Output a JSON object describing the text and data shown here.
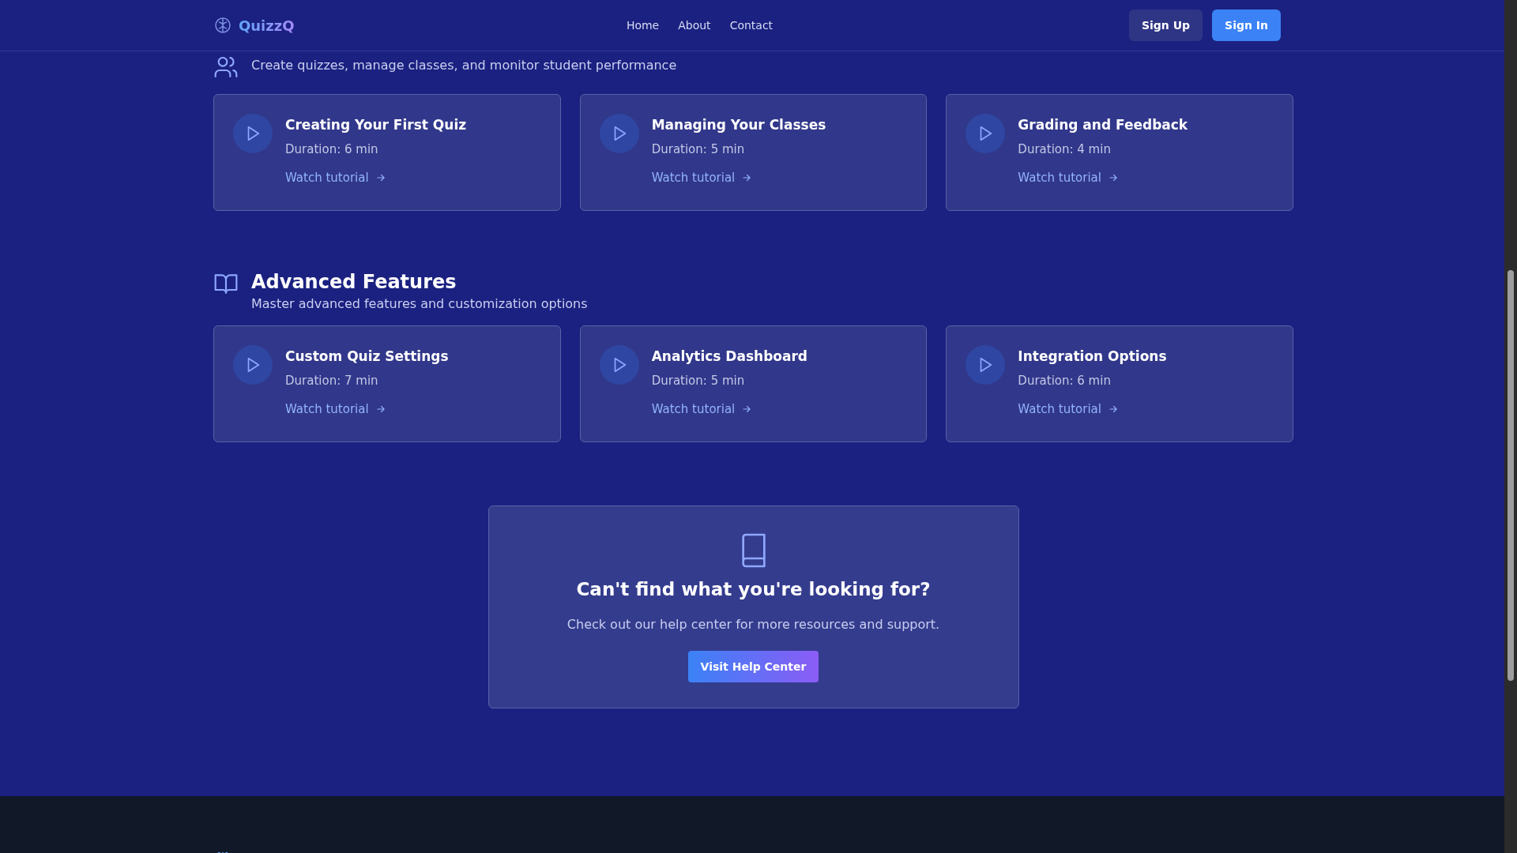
{
  "header": {
    "brand": "QuizzQ",
    "nav": [
      {
        "label": "Home"
      },
      {
        "label": "About"
      },
      {
        "label": "Contact"
      }
    ],
    "sign_up": "Sign Up",
    "sign_in": "Sign In"
  },
  "sections": [
    {
      "subtitle": "Create quizzes, manage classes, and monitor student performance",
      "tutorials": [
        {
          "title": "Creating Your First Quiz",
          "duration": "Duration: 6 min",
          "link": "Watch tutorial"
        },
        {
          "title": "Managing Your Classes",
          "duration": "Duration: 5 min",
          "link": "Watch tutorial"
        },
        {
          "title": "Grading and Feedback",
          "duration": "Duration: 4 min",
          "link": "Watch tutorial"
        }
      ]
    },
    {
      "title": "Advanced Features",
      "subtitle": "Master advanced features and customization options",
      "tutorials": [
        {
          "title": "Custom Quiz Settings",
          "duration": "Duration: 7 min",
          "link": "Watch tutorial"
        },
        {
          "title": "Analytics Dashboard",
          "duration": "Duration: 5 min",
          "link": "Watch tutorial"
        },
        {
          "title": "Integration Options",
          "duration": "Duration: 6 min",
          "link": "Watch tutorial"
        }
      ]
    }
  ],
  "help": {
    "title": "Can't find what you're looking for?",
    "text": "Check out our help center for more resources and support.",
    "button": "Visit Help Center"
  }
}
